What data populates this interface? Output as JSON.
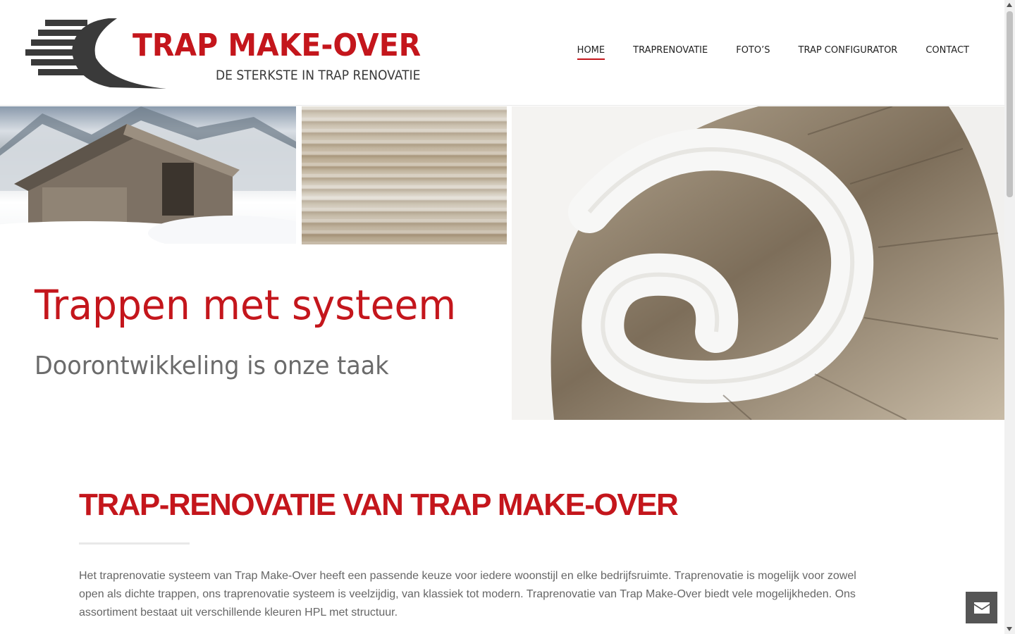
{
  "header": {
    "logo": {
      "title": "TRAP MAKE-OVER",
      "tagline": "DE STERKSTE IN TRAP RENOVATIE"
    },
    "nav": [
      {
        "label": "HOME",
        "active": true
      },
      {
        "label": "TRAPRENOVATIE",
        "active": false
      },
      {
        "label": "FOTO’S",
        "active": false
      },
      {
        "label": "TRAP CONFIGURATOR",
        "active": false
      },
      {
        "label": "CONTACT",
        "active": false
      }
    ]
  },
  "hero": {
    "title": "Trappen met systeem",
    "subtitle": "Doorontwikkeling is onze taak",
    "images": [
      "snowy-wooden-cabin",
      "weathered-wood-texture",
      "spiral-staircase"
    ]
  },
  "content": {
    "heading": "TRAP-RENOVATIE VAN TRAP MAKE-OVER",
    "paragraph": "Het traprenovatie systeem van Trap Make-Over heeft een passende keuze voor iedere woonstijl en elke bedrijfsruimte. Traprenovatie is mogelijk voor zowel open als dichte trappen, ons traprenovatie systeem is veelzijdig, van klassiek tot modern. Traprenovatie van Trap Make-Over biedt vele mogelijkheden. Ons assortiment bestaat uit verschillende kleuren HPL met structuur."
  },
  "contact_button": {
    "icon": "envelope-icon"
  },
  "colors": {
    "brand_red": "#c4161c",
    "text_gray": "#666666",
    "fab_gray": "#555555"
  }
}
